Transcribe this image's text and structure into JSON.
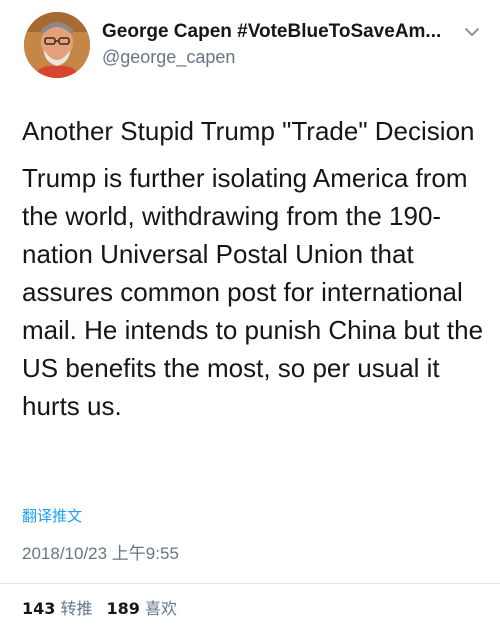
{
  "user": {
    "display_name": "George Capen #VoteBlueToSaveAm...",
    "handle": "@george_capen"
  },
  "tweet": {
    "paragraphs": [
      "Another Stupid Trump \"Trade\" Decision",
      "Trump is further isolating America from the world, withdrawing from the 190-nation Universal Postal Union that assures common post for international mail. He intends to punish China but the US benefits the most, so per usual it hurts us."
    ],
    "translate_label": "翻译推文",
    "timestamp": "2018/10/23 上午9:55"
  },
  "stats": {
    "retweets_count": "143",
    "retweets_label": "转推",
    "likes_count": "189",
    "likes_label": "喜欢"
  },
  "icons": {
    "caret": "chevron-down-icon"
  },
  "colors": {
    "link": "#1da1f2",
    "secondary_text": "#657786",
    "primary_text": "#14171a"
  }
}
